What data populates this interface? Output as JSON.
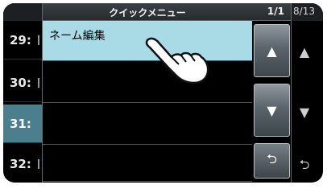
{
  "background_list": {
    "page_indicator": "8/13",
    "channels": [
      {
        "label": "29:",
        "selected": false
      },
      {
        "label": "30:",
        "selected": false
      },
      {
        "label": "31:",
        "selected": true
      },
      {
        "label": "32:",
        "selected": false
      }
    ],
    "nav": {
      "up": "▲",
      "down": "▼",
      "back": "⮌"
    }
  },
  "quick_menu": {
    "title": "クイックメニュー",
    "page": "1/1",
    "items": [
      {
        "label": "ネーム編集",
        "highlighted": true
      },
      {
        "label": "",
        "highlighted": false
      },
      {
        "label": "",
        "highlighted": false
      },
      {
        "label": "",
        "highlighted": false
      }
    ],
    "buttons": {
      "up": "▲",
      "down": "▼",
      "back": "⮌"
    }
  },
  "colors": {
    "highlight": "#a8dbe6",
    "selected_channel": "#4b7f8e",
    "screen_bg": "#000000"
  },
  "icons": {
    "pointer": "pointing-hand-icon"
  }
}
